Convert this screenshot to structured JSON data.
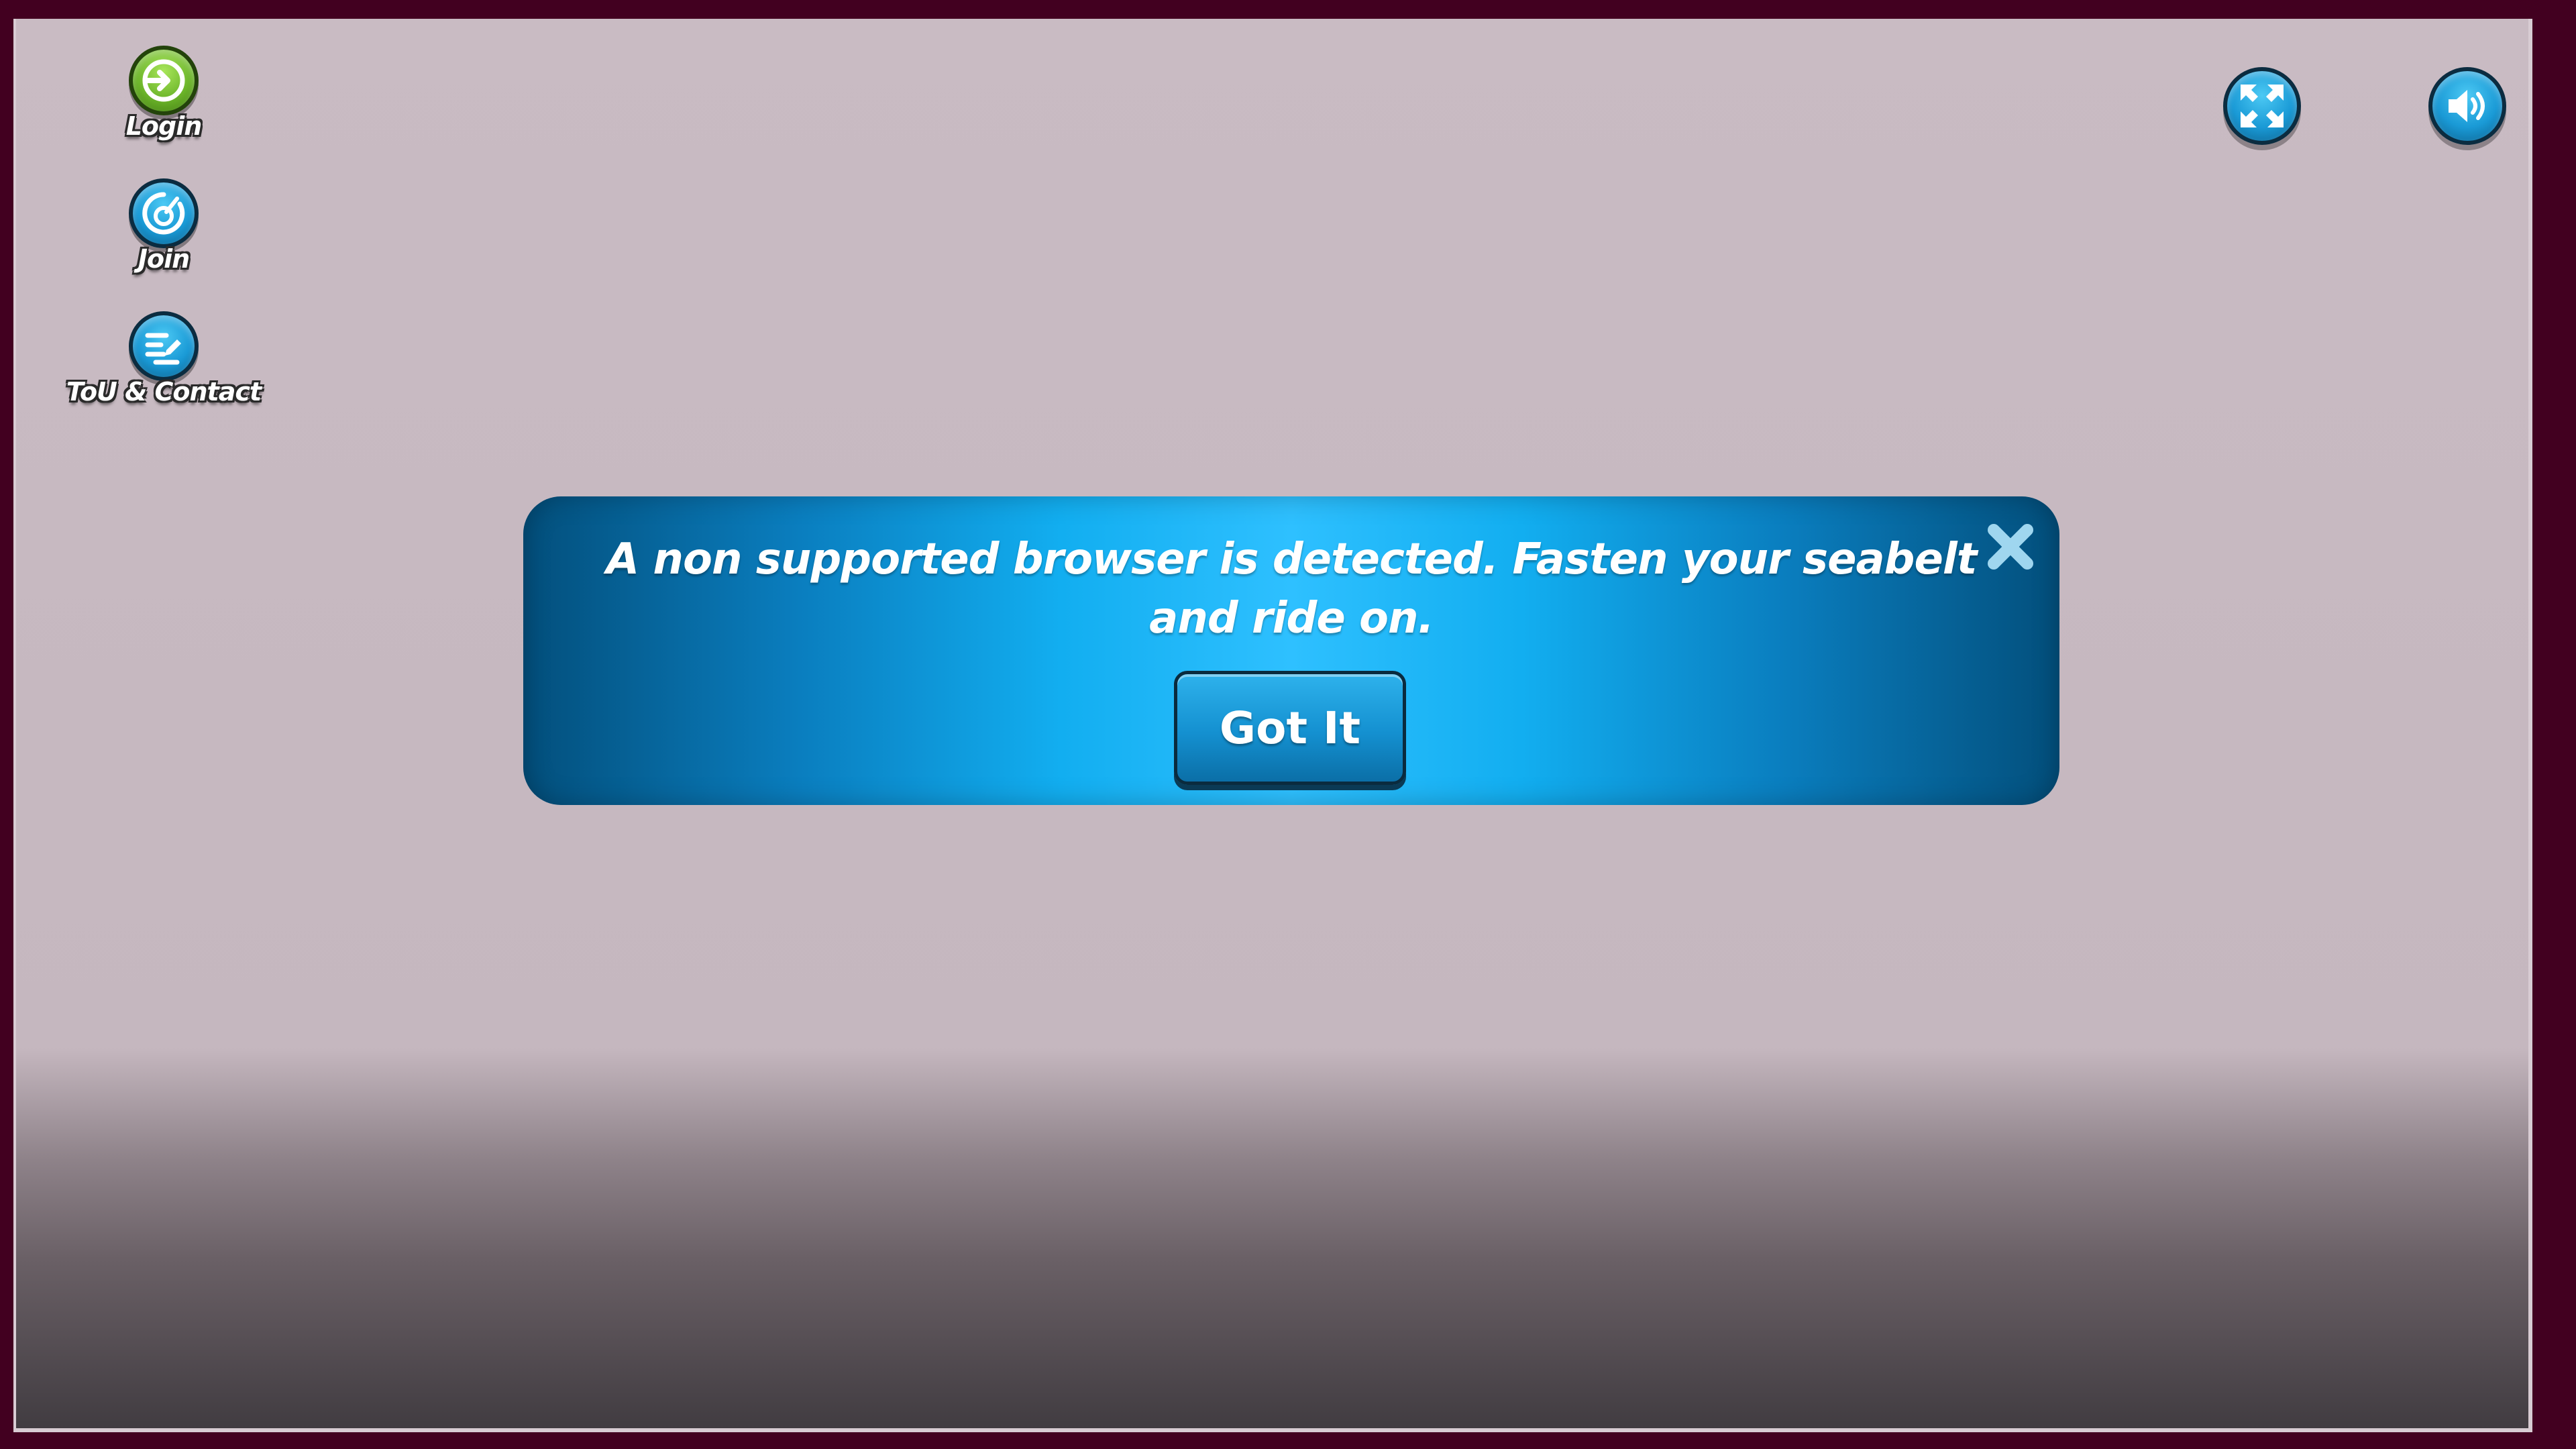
{
  "sidebar": {
    "items": [
      {
        "label": "Login",
        "icon": "login-icon"
      },
      {
        "label": "Join",
        "icon": "join-icon"
      },
      {
        "label": "ToU & Contact",
        "icon": "tou-contact-icon"
      }
    ]
  },
  "top_controls": {
    "fullscreen_icon": "fullscreen-icon",
    "sound_icon": "sound-icon"
  },
  "dialog": {
    "message": "A non supported browser is detected. Fasten your seabelt and ride on.",
    "button_label": "Got It",
    "close_icon": "close-icon"
  },
  "colors": {
    "outer_background": "#420020",
    "dialog_blue": "#12aef0",
    "login_green": "#6cb52a"
  }
}
